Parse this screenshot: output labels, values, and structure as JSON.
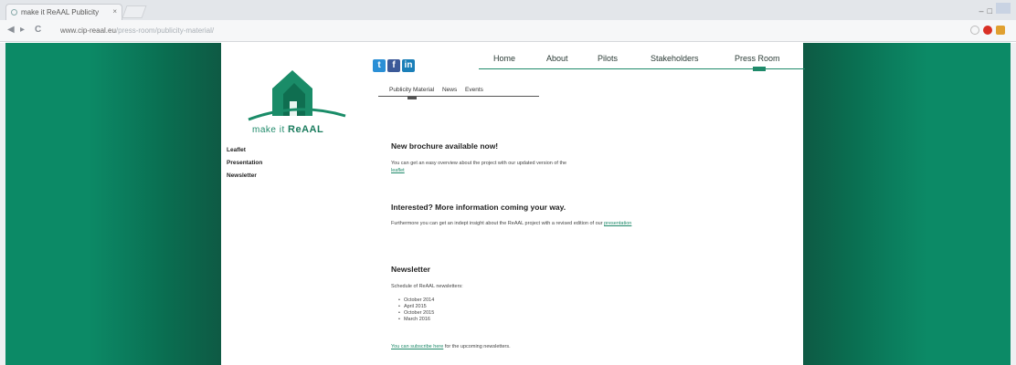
{
  "browser": {
    "tab_title": "make it ReAAL Publicity",
    "tab_close": "×",
    "url_host": "www.cip-reaal.eu",
    "url_path": "/press-room/publicity-material/",
    "nav_back": "◀",
    "nav_forward": "▸",
    "nav_reload": "C"
  },
  "logo": {
    "prefix": "make it ",
    "brand": "ReAAL"
  },
  "social": {
    "twitter": "t",
    "facebook": "f",
    "linkedin": "in"
  },
  "main_nav": [
    "Home",
    "About",
    "Pilots",
    "Stakeholders",
    "Press Room"
  ],
  "sub_nav": [
    "Publicity Material",
    "News",
    "Events"
  ],
  "side_menu": [
    "Leaflet",
    "Presentation",
    "Newsletter"
  ],
  "sections": {
    "brochure": {
      "heading": "New brochure available now!",
      "text": "You can get an easy overview about the project with our updated version of the",
      "link": "leaflet"
    },
    "interested": {
      "heading": "Interested? More information coming your way.",
      "text": "Furthermore you can get an indept insight about the ReAAL project with a revised edition of our",
      "link": "presentation"
    },
    "newsletter": {
      "heading": "Newsletter",
      "intro": "Schedule of ReAAL newsletters:",
      "months": [
        "October 2014",
        "April 2015",
        "October 2015",
        "March 2016"
      ],
      "link": "You can subscribe here",
      "suffix": "for the upcoming newsletters."
    }
  },
  "colors": {
    "brand_green": "#0c8a66",
    "link_green": "#1f8a6a"
  }
}
